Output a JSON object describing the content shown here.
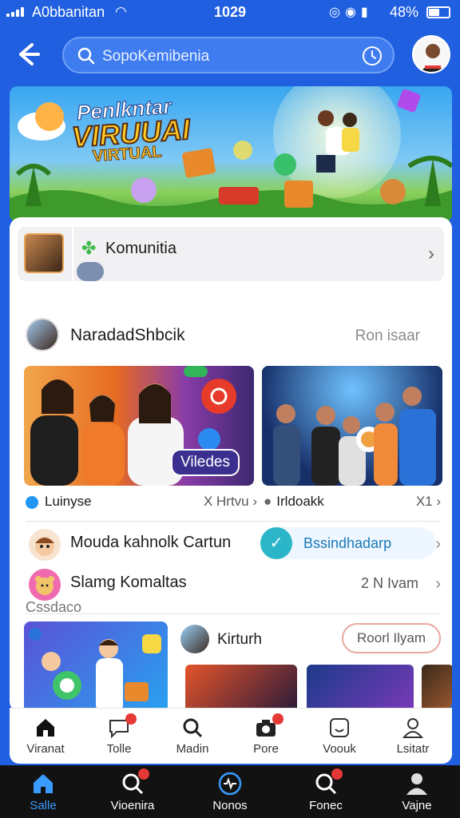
{
  "status_bar": {
    "carrier": "A0bbanitan",
    "time": "1029",
    "battery": "48%"
  },
  "header": {
    "search_placeholder": "SopoKemibenia"
  },
  "banner": {
    "line1": "Penlkntar",
    "line2": "VIRUUAI",
    "line3": "VIRTUAL"
  },
  "komunitas": {
    "label": "Komunitia"
  },
  "section": {
    "title": "NaradadShbcik",
    "right_label": "Ron isaar"
  },
  "cards": [
    {
      "tag": "Viledes",
      "meta_label": "Luinyse",
      "meta_right": "X Hrtvu ›"
    },
    {
      "meta_label": "Irldoakk",
      "meta_right": "X1 ›"
    }
  ],
  "rows": {
    "row1_text": "Mouda kahnolk Cartun",
    "row1_pill": "Bssindhadarp",
    "row2_text": "Slamg Komaltas",
    "row2_sub": "Cssdaco",
    "row2_right": "2 N Ivam"
  },
  "bottom_section": {
    "title": "Kirturh",
    "button": "Roorl Ilyam"
  },
  "inner_tabs": [
    {
      "label": "Viranat",
      "icon": "home-icon"
    },
    {
      "label": "Tolle",
      "icon": "chat-icon"
    },
    {
      "label": "Madin",
      "icon": "search-icon"
    },
    {
      "label": "Pore",
      "icon": "camera-icon"
    },
    {
      "label": "Voouk",
      "icon": "face-icon"
    },
    {
      "label": "Lsitatr",
      "icon": "person-icon"
    }
  ],
  "bottom_nav": [
    {
      "label": "Salle",
      "icon": "home-icon"
    },
    {
      "label": "Vioenira",
      "icon": "search-icon"
    },
    {
      "label": "Nonos",
      "icon": "pulse-icon"
    },
    {
      "label": "Fonec",
      "icon": "search-icon"
    },
    {
      "label": "Vajne",
      "icon": "person-icon"
    }
  ]
}
